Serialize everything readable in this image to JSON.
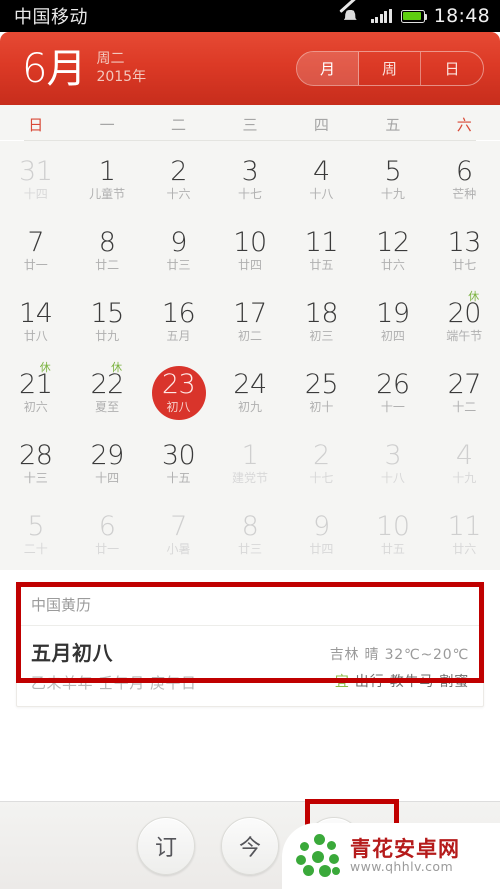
{
  "status_bar": {
    "carrier": "中国移动",
    "time": "18:48",
    "icons": [
      "mute-icon",
      "signal-icon",
      "battery-icon"
    ]
  },
  "header": {
    "month": "6月",
    "weekday": "周二",
    "year": "2015年",
    "view_tabs": [
      {
        "label": "月",
        "active": true
      },
      {
        "label": "周",
        "active": false
      },
      {
        "label": "日",
        "active": false
      }
    ],
    "accent_color": "#d9342b"
  },
  "weekdays": [
    {
      "label": "日",
      "weekend": true
    },
    {
      "label": "一",
      "weekend": false
    },
    {
      "label": "二",
      "weekend": false
    },
    {
      "label": "三",
      "weekend": false
    },
    {
      "label": "四",
      "weekend": false
    },
    {
      "label": "五",
      "weekend": false
    },
    {
      "label": "六",
      "weekend": true
    }
  ],
  "calendar": {
    "weeks": [
      [
        {
          "num": "31",
          "sub": "十四",
          "out": true
        },
        {
          "num": "1",
          "sub": "儿童节",
          "out": false
        },
        {
          "num": "2",
          "sub": "十六",
          "out": false
        },
        {
          "num": "3",
          "sub": "十七",
          "out": false
        },
        {
          "num": "4",
          "sub": "十八",
          "out": false
        },
        {
          "num": "5",
          "sub": "十九",
          "out": false
        },
        {
          "num": "6",
          "sub": "芒种",
          "out": false
        }
      ],
      [
        {
          "num": "7",
          "sub": "廿一",
          "out": false
        },
        {
          "num": "8",
          "sub": "廿二",
          "out": false
        },
        {
          "num": "9",
          "sub": "廿三",
          "out": false
        },
        {
          "num": "10",
          "sub": "廿四",
          "out": false
        },
        {
          "num": "11",
          "sub": "廿五",
          "out": false
        },
        {
          "num": "12",
          "sub": "廿六",
          "out": false
        },
        {
          "num": "13",
          "sub": "廿七",
          "out": false
        }
      ],
      [
        {
          "num": "14",
          "sub": "廿八",
          "out": false
        },
        {
          "num": "15",
          "sub": "廿九",
          "out": false
        },
        {
          "num": "16",
          "sub": "五月",
          "out": false
        },
        {
          "num": "17",
          "sub": "初二",
          "out": false
        },
        {
          "num": "18",
          "sub": "初三",
          "out": false
        },
        {
          "num": "19",
          "sub": "初四",
          "out": false
        },
        {
          "num": "20",
          "sub": "端午节",
          "out": false,
          "rest": "休"
        }
      ],
      [
        {
          "num": "21",
          "sub": "初六",
          "out": false,
          "rest": "休"
        },
        {
          "num": "22",
          "sub": "夏至",
          "out": false,
          "rest": "休"
        },
        {
          "num": "23",
          "sub": "初八",
          "out": false,
          "selected": true
        },
        {
          "num": "24",
          "sub": "初九",
          "out": false
        },
        {
          "num": "25",
          "sub": "初十",
          "out": false
        },
        {
          "num": "26",
          "sub": "十一",
          "out": false
        },
        {
          "num": "27",
          "sub": "十二",
          "out": false
        }
      ],
      [
        {
          "num": "28",
          "sub": "十三",
          "out": false
        },
        {
          "num": "29",
          "sub": "十四",
          "out": false
        },
        {
          "num": "30",
          "sub": "十五",
          "out": false
        },
        {
          "num": "1",
          "sub": "建党节",
          "out": true
        },
        {
          "num": "2",
          "sub": "十七",
          "out": true
        },
        {
          "num": "3",
          "sub": "十八",
          "out": true
        },
        {
          "num": "4",
          "sub": "十九",
          "out": true
        }
      ],
      [
        {
          "num": "5",
          "sub": "二十",
          "out": true
        },
        {
          "num": "6",
          "sub": "廿一",
          "out": true
        },
        {
          "num": "7",
          "sub": "小暑",
          "out": true
        },
        {
          "num": "8",
          "sub": "廿三",
          "out": true
        },
        {
          "num": "9",
          "sub": "廿四",
          "out": true
        },
        {
          "num": "10",
          "sub": "廿五",
          "out": true
        },
        {
          "num": "11",
          "sub": "廿六",
          "out": true
        }
      ]
    ]
  },
  "almanac": {
    "title": "中国黄历",
    "lunar_date": "五月初八",
    "ganzhi": "乙未羊年 壬午月 庚午日",
    "weather": "吉林 晴 32℃~20℃",
    "yi_label": "宜",
    "yi_items": "出行 教牛马 割蜜"
  },
  "bottom_bar": {
    "buttons": [
      {
        "label": "订",
        "name": "subscribe-button"
      },
      {
        "label": "今",
        "name": "today-button"
      },
      {
        "label": "+",
        "name": "add-event-button"
      }
    ]
  },
  "watermark": {
    "site_name": "青花安卓网",
    "url": "www.qhhlv.com"
  }
}
